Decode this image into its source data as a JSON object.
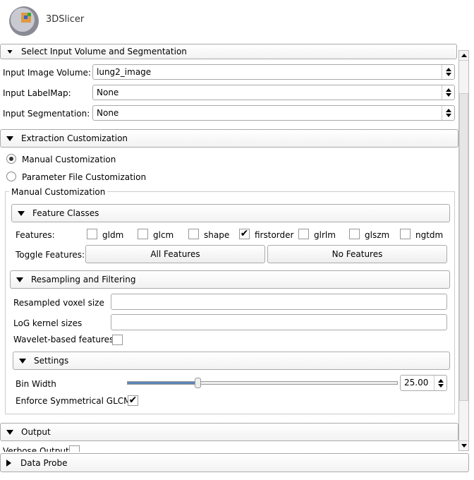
{
  "app": {
    "logo_text": "3DSlicer"
  },
  "sections": {
    "input": {
      "title": "Select Input Volume and Segmentation",
      "image_volume_label": "Input Image Volume:",
      "image_volume_value": "lung2_image",
      "labelmap_label": "Input LabelMap:",
      "labelmap_value": "None",
      "segmentation_label": "Input Segmentation:",
      "segmentation_value": "None"
    },
    "extraction": {
      "title": "Extraction Customization",
      "radio_manual": "Manual Customization",
      "radio_param": "Parameter File Customization",
      "manual_selected": true,
      "group_title": "Manual Customization"
    },
    "feature_classes": {
      "title": "Feature Classes",
      "features_label": "Features:",
      "features": [
        {
          "label": "gldm",
          "checked": false
        },
        {
          "label": "glcm",
          "checked": false
        },
        {
          "label": "shape",
          "checked": false
        },
        {
          "label": "firstorder",
          "checked": true
        },
        {
          "label": "glrlm",
          "checked": false
        },
        {
          "label": "glszm",
          "checked": false
        },
        {
          "label": "ngtdm",
          "checked": false
        }
      ],
      "toggle_label": "Toggle Features:",
      "all_button": "All Features",
      "none_button": "No Features"
    },
    "resampling": {
      "title": "Resampling and Filtering",
      "voxel_label": "Resampled voxel size",
      "voxel_value": "",
      "log_label": "LoG kernel sizes",
      "log_value": "",
      "wavelet_label": "Wavelet-based features",
      "wavelet_checked": false
    },
    "settings": {
      "title": "Settings",
      "bin_width_label": "Bin Width",
      "bin_width_value": "25.00",
      "bin_width_slider_fraction": 0.26,
      "glcm_label": "Enforce Symmetrical GLCM",
      "glcm_checked": true
    },
    "output": {
      "title": "Output",
      "verbose_label": "Verbose Output"
    },
    "data_probe": {
      "title": "Data Probe"
    }
  },
  "icons": {
    "checkmark": "✔"
  }
}
